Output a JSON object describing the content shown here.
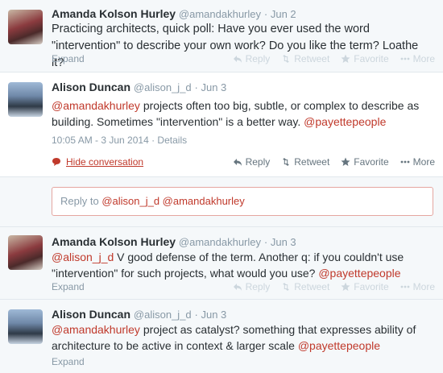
{
  "tweets": [
    {
      "name": "Amanda Kolson Hurley",
      "handle": "@amandakhurley",
      "time": "· Jun 2",
      "text": "Practicing architects, quick poll: Have you ever used the word \"intervention\" to describe your own work? Do you like the term? Loathe it?",
      "expand": "Expand"
    },
    {
      "name": "Alison Duncan",
      "handle": "@alison_j_d",
      "time": "· Jun 3",
      "mention1": "@amandakhurley",
      "text": " projects often too big, subtle, or complex to describe as building. Sometimes \"intervention\" is a better way. ",
      "mention2": "@payettepeople",
      "timestamp": "10:05 AM - 3 Jun 2014",
      "details": "· Details",
      "hide": "Hide conversation"
    },
    {
      "name": "Amanda Kolson Hurley",
      "handle": "@amandakhurley",
      "time": "· Jun 3",
      "mention1": "@alison_j_d",
      "text": " V good defense of the term. Another q: if you couldn't use \"intervention\" for such projects, what would you use? ",
      "mention2": "@payettepeople",
      "expand": "Expand"
    },
    {
      "name": "Alison Duncan",
      "handle": "@alison_j_d",
      "time": "· Jun 3",
      "mention1": "@amandakhurley",
      "text": " project as catalyst? something that expresses ability of architecture to be active in context & larger scale ",
      "mention2": "@payettepeople",
      "expand": "Expand"
    }
  ],
  "reply": {
    "prefix": "Reply to ",
    "mentions": "@alison_j_d @amandakhurley"
  },
  "actions": {
    "reply": "Reply",
    "retweet": "Retweet",
    "favorite": "Favorite",
    "more": "More"
  },
  "colors": {
    "accent": "#c0392b",
    "muted": "#8899a6",
    "text": "#292f33"
  }
}
